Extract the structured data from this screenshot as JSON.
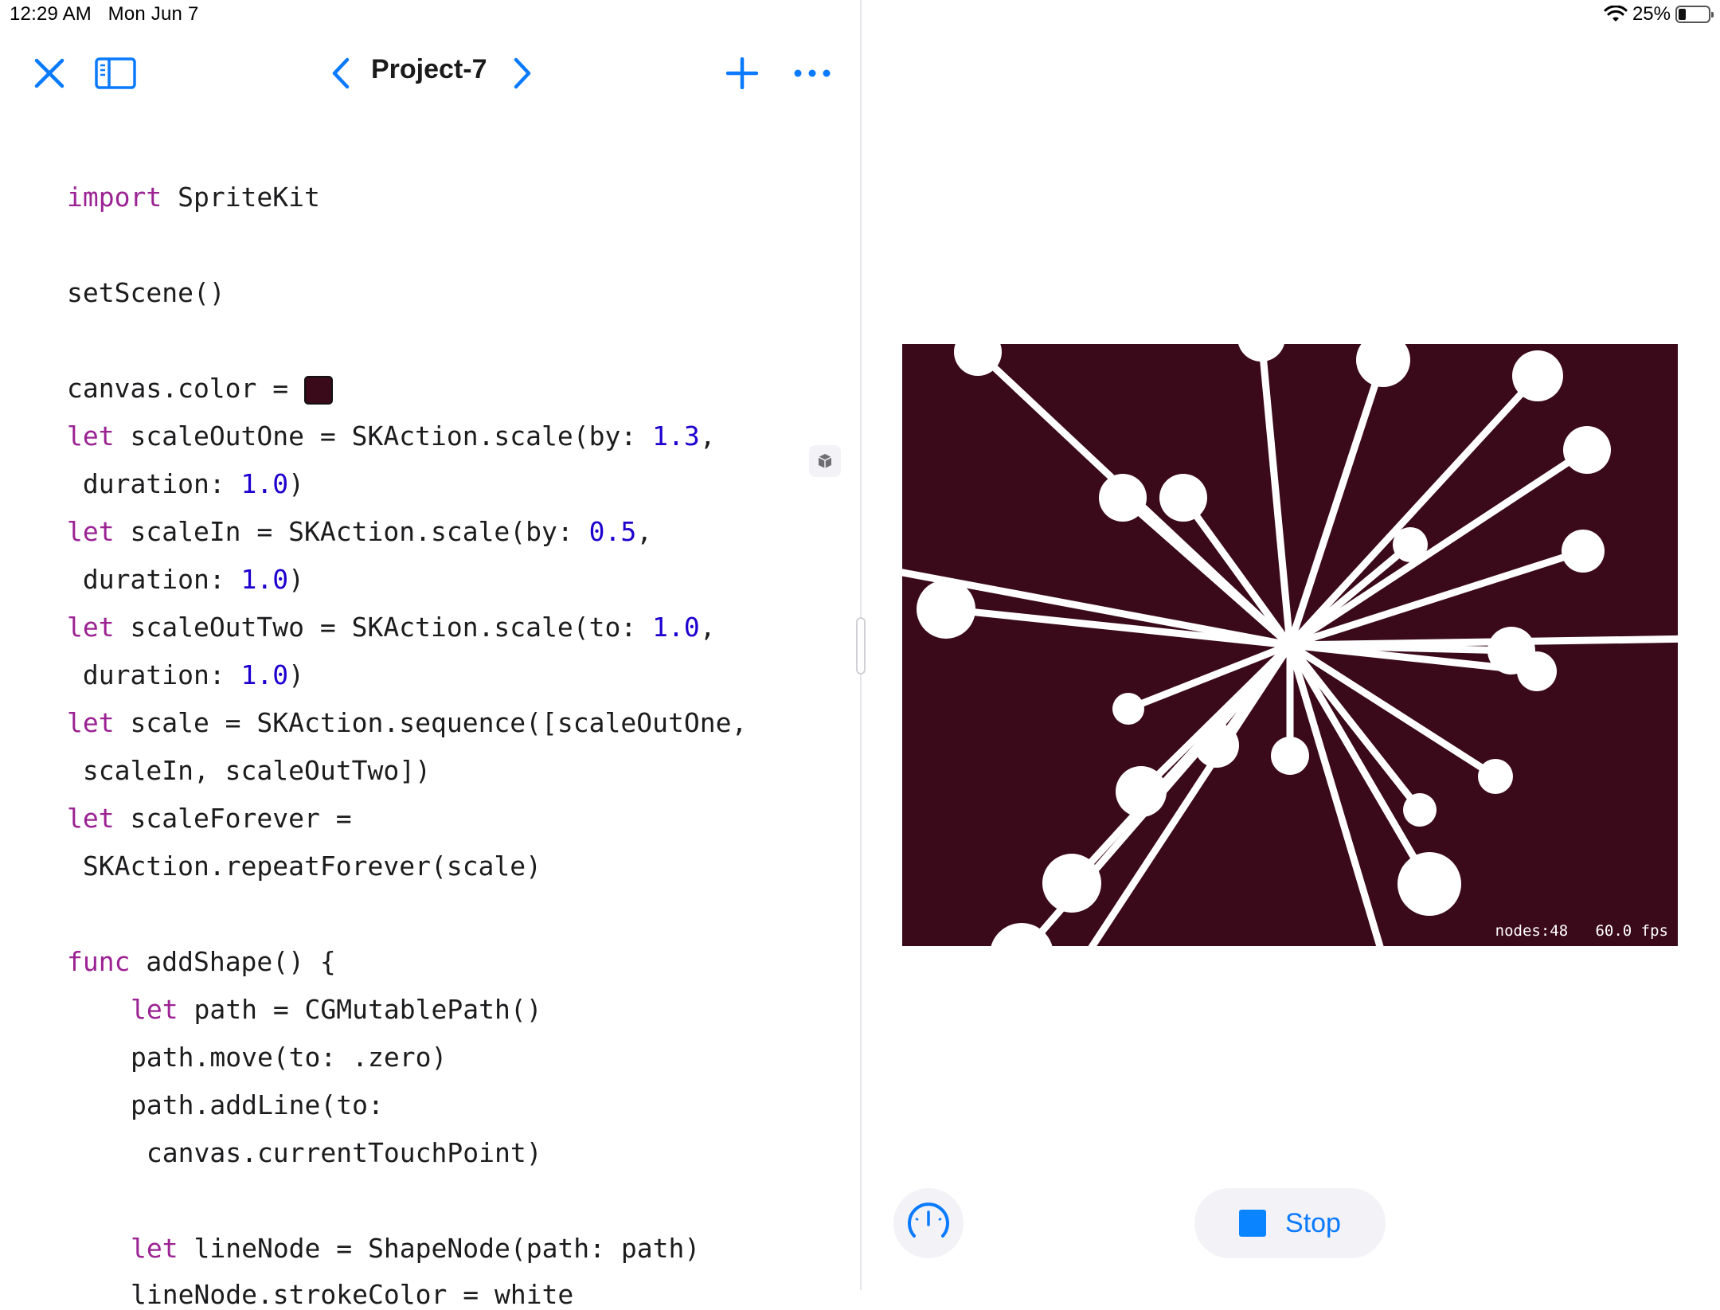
{
  "status": {
    "time": "12:29 AM",
    "date": "Mon Jun 7",
    "battery": "25%",
    "battery_level": 0.25
  },
  "toolbar": {
    "title": "Project-7",
    "icons": [
      "close-icon",
      "sidebar-icon",
      "chevron-left-icon",
      "chevron-right-icon",
      "plus-icon",
      "more-icon"
    ]
  },
  "code": {
    "l1_kw": "import",
    "l1_rest": " SpriteKit",
    "l2": "setScene()",
    "l3": "canvas.color = ",
    "l4_kw": "let",
    "l4_a": " scaleOutOne = SKAction.scale(by: ",
    "l4_num": "1.3",
    "l4_b": ",",
    "l5_a": " duration: ",
    "l5_num": "1.0",
    "l5_b": ")",
    "l6_kw": "let",
    "l6_a": " scaleIn = SKAction.scale(by: ",
    "l6_num": "0.5",
    "l6_b": ",",
    "l7_a": " duration: ",
    "l7_num": "1.0",
    "l7_b": ")",
    "l8_kw": "let",
    "l8_a": " scaleOutTwo = SKAction.scale(to: ",
    "l8_num": "1.0",
    "l8_b": ",",
    "l9_a": " duration: ",
    "l9_num": "1.0",
    "l9_b": ")",
    "l10_kw": "let",
    "l10_a": " scale = SKAction.sequence([scaleOutOne,",
    "l11": " scaleIn, scaleOutTwo])",
    "l12_kw": "let",
    "l12_a": " scaleForever =",
    "l13": " SKAction.repeatForever(scale)",
    "l14_kw": "func",
    "l14_a": " addShape() {",
    "l15_kw": "let",
    "l15_a": " path = CGMutablePath()",
    "l16": "path.move(to: .zero)",
    "l17": "path.addLine(to:",
    "l18": " canvas.currentTouchPoint)",
    "l19_kw": "let",
    "l19_a": " lineNode = ShapeNode(path: path)",
    "l20": "lineNode.strokeColor = white"
  },
  "canvas": {
    "background": "#3b0a1a",
    "nodes_label": "nodes:48",
    "fps_label": "60.0 fps"
  },
  "controls": {
    "stop_label": "Stop"
  },
  "colors": {
    "accent": "#0a7aff",
    "keyword": "#9b2393",
    "number": "#1c00cf"
  }
}
